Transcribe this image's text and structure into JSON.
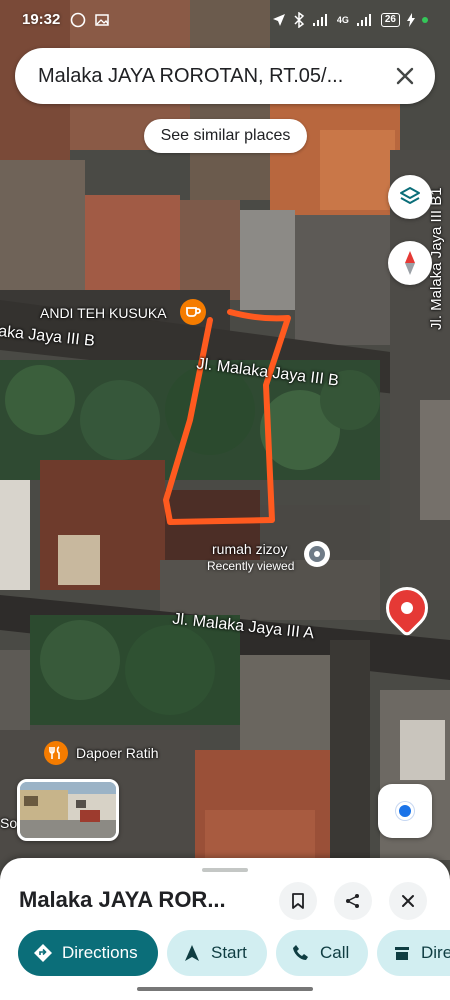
{
  "status_bar": {
    "time": "19:32",
    "battery": "26",
    "network": "4G"
  },
  "search": {
    "query": "Malaka JAYA ROROTAN, RT.05/..."
  },
  "chip": {
    "label": "See similar places"
  },
  "map_labels": {
    "road_b_left": "aka Jaya III B",
    "road_b_main": "Jl. Malaka Jaya III B",
    "road_a": "Jl. Malaka Jaya III A",
    "road_b1": "Jl. Malaka Jaya III B1"
  },
  "pois": {
    "andi": {
      "name": "ANDI TEH KUSUKA",
      "icon": "coffee-icon",
      "color": "#f57c00"
    },
    "rumah": {
      "name": "rumah zizoy",
      "subtitle": "Recently viewed",
      "icon": "visited-place-icon"
    },
    "dapoer": {
      "name": "Dapoer Ratih",
      "icon": "restaurant-icon",
      "color": "#f57c00"
    },
    "partial": "So"
  },
  "pin": {
    "icon": "red-location-pin-icon",
    "color": "#e53935"
  },
  "sheet": {
    "title": "Malaka JAYA ROR...",
    "actions": {
      "directions": "Directions",
      "start": "Start",
      "call": "Call",
      "dire": "Dire"
    }
  },
  "colors": {
    "accent": "#0b6e79",
    "chip_bg": "#d2eef1",
    "annotation": "#ff5a1f"
  }
}
